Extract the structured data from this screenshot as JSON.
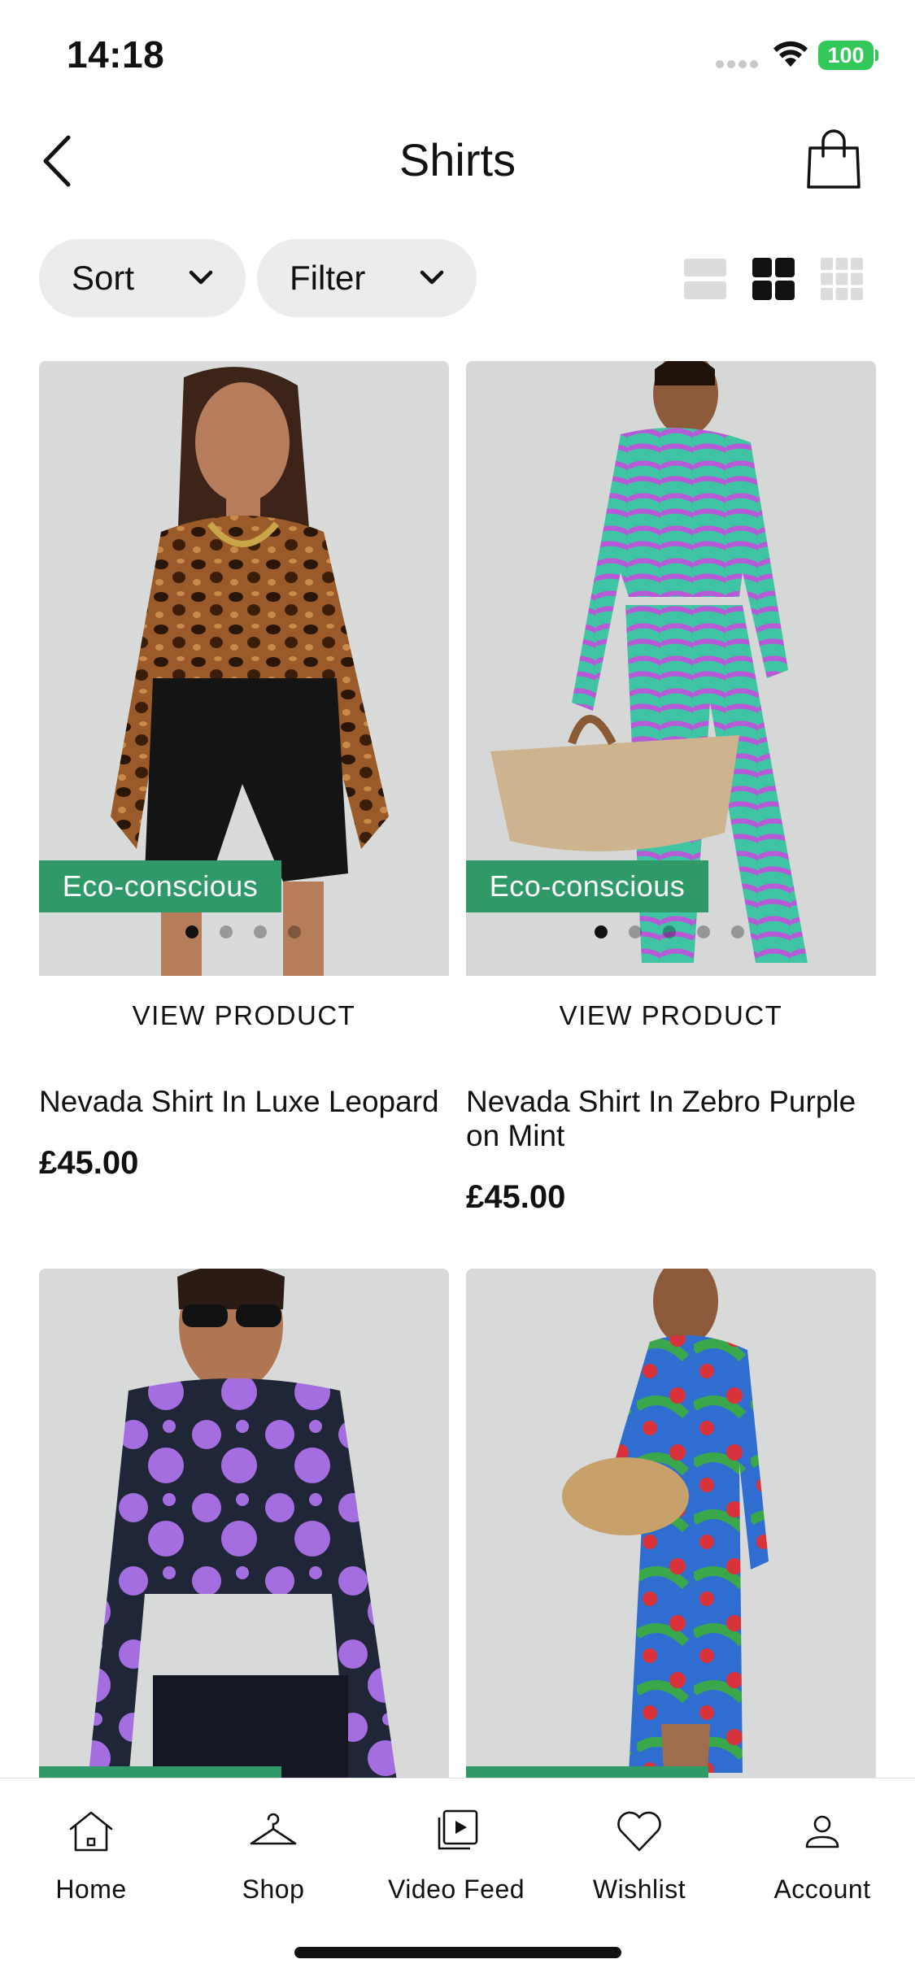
{
  "status_bar": {
    "time": "14:18",
    "battery": "100"
  },
  "header": {
    "title": "Shirts"
  },
  "toolbar": {
    "sort_label": "Sort",
    "filter_label": "Filter"
  },
  "products": [
    {
      "badge": "Eco-conscious",
      "cta": "VIEW PRODUCT",
      "name": "Nevada Shirt In Luxe Leopard",
      "price": "£45.00",
      "image_count": 4,
      "active_image": 1
    },
    {
      "badge": "Eco-conscious",
      "cta": "VIEW PRODUCT",
      "name": "Nevada Shirt In Zebro Purple on Mint",
      "price": "£45.00",
      "image_count": 5,
      "active_image": 1
    },
    {
      "badge": "",
      "cta": "",
      "name": "",
      "price": ""
    },
    {
      "badge": "",
      "cta": "",
      "name": "",
      "price": ""
    }
  ],
  "tab_bar": {
    "items": [
      {
        "label": "Home",
        "icon": "home-icon"
      },
      {
        "label": "Shop",
        "icon": "hanger-icon"
      },
      {
        "label": "Video Feed",
        "icon": "video-feed-icon"
      },
      {
        "label": "Wishlist",
        "icon": "heart-icon"
      },
      {
        "label": "Account",
        "icon": "account-icon"
      }
    ]
  },
  "colors": {
    "eco_badge": "#2f9a68",
    "pill_bg": "#ececec",
    "battery": "#34c759"
  }
}
